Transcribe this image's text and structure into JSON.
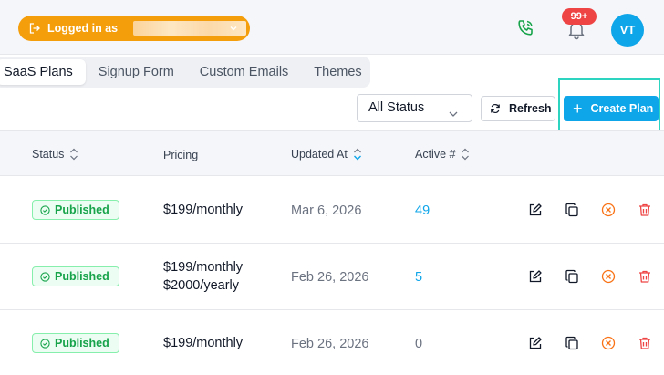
{
  "header": {
    "login_label": "Logged in as",
    "notification_count": "99+",
    "avatar_initials": "VT"
  },
  "tabs": [
    {
      "label": "SaaS Plans",
      "active": true
    },
    {
      "label": "Signup Form",
      "active": false
    },
    {
      "label": "Custom Emails",
      "active": false
    },
    {
      "label": "Themes",
      "active": false
    }
  ],
  "toolbar": {
    "status_filter": "All Status",
    "refresh_label": "Refresh",
    "create_label": "Create Plan"
  },
  "table": {
    "columns": {
      "status": "Status",
      "pricing": "Pricing",
      "updated_at": "Updated At",
      "active": "Active #"
    },
    "rows": [
      {
        "status": "Published",
        "pricing_1": "$199/monthly",
        "pricing_2": "",
        "updated": "Mar 6, 2026",
        "active": "49"
      },
      {
        "status": "Published",
        "pricing_1": "$199/monthly",
        "pricing_2": "$2000/yearly",
        "updated": "Feb 26, 2026",
        "active": "5"
      },
      {
        "status": "Published",
        "pricing_1": "$199/monthly",
        "pricing_2": "",
        "updated": "Feb 26, 2026",
        "active": "0"
      }
    ]
  },
  "colors": {
    "accent": "#0ea5e9",
    "login_pill": "#f59e0b",
    "published_text": "#16a34a",
    "highlight_border": "#2dd4bf",
    "delete": "#ef4444",
    "deactivate": "#f97316"
  },
  "icons": [
    "logout-icon",
    "chevron-down-icon",
    "phone-icon",
    "bell-icon",
    "refresh-icon",
    "plus-icon",
    "sort-icon",
    "check-circle-icon",
    "edit-icon",
    "copy-icon",
    "deactivate-icon",
    "delete-icon"
  ]
}
